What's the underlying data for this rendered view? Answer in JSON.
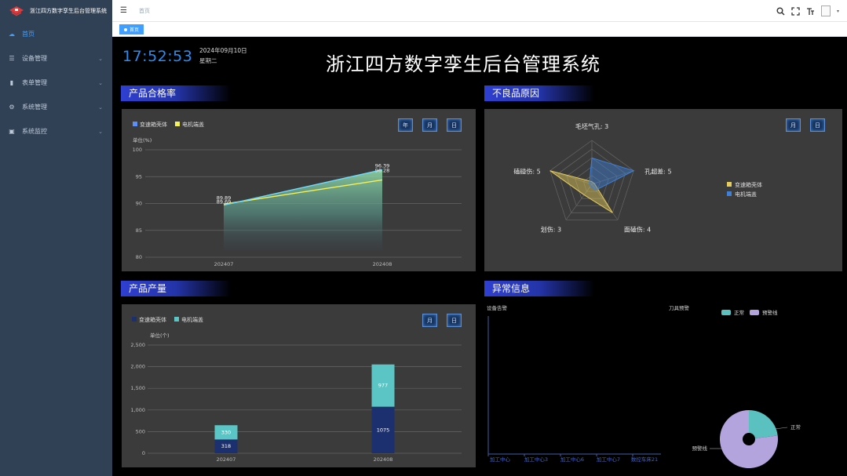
{
  "app": {
    "title": "浙江四方数字孪生后台管理系统"
  },
  "sidebar": {
    "items": [
      {
        "label": "首页",
        "icon": "dashboard-icon",
        "active": true
      },
      {
        "label": "设备管理",
        "icon": "device-icon"
      },
      {
        "label": "表单管理",
        "icon": "chart-bar-icon"
      },
      {
        "label": "系统管理",
        "icon": "gear-icon"
      },
      {
        "label": "系统监控",
        "icon": "monitor-icon"
      }
    ]
  },
  "topbar": {
    "breadcrumb": "首页"
  },
  "tags": {
    "active": "首页"
  },
  "dashboard": {
    "time": "17:52:53",
    "date": "2024年09月10日",
    "weekday": "星期二",
    "title": "浙江四方数字孪生后台管理系统"
  },
  "sections": {
    "pass_rate": {
      "title": "产品合格率",
      "buttons": [
        "年",
        "月",
        "日"
      ]
    },
    "defect": {
      "title": "不良品原因",
      "buttons": [
        "月",
        "日"
      ]
    },
    "output": {
      "title": "产品产量",
      "buttons": [
        "月",
        "日"
      ]
    },
    "abnormal": {
      "title": "异常信息",
      "sub_left": "设备告警",
      "sub_right": "刀具预警"
    }
  },
  "chart_data": [
    {
      "type": "area",
      "ylabel": "单位(%)",
      "categories": [
        "202407",
        "202408"
      ],
      "ylim": [
        80,
        100
      ],
      "yticks": [
        "80",
        "85",
        "90",
        "95",
        "100"
      ],
      "series": [
        {
          "name": "变速箱壳体",
          "color": "#5b8ff9",
          "values": [
            89.69,
            96.28
          ]
        },
        {
          "name": "电机端盖",
          "color": "#f6f155",
          "values": [
            89.89,
            94.39
          ]
        }
      ],
      "labels": {
        "series1": [
          "89.69",
          "96.28"
        ],
        "series2": [
          "89.89",
          "96.39"
        ]
      },
      "legend": "top-left",
      "grid": true
    },
    {
      "type": "radar",
      "indicators": [
        {
          "name": "毛坯气孔",
          "value": "3"
        },
        {
          "name": "孔超差",
          "value": "5"
        },
        {
          "name": "面磕伤",
          "value": "4"
        },
        {
          "name": "划伤",
          "value": "3"
        },
        {
          "name": "磕碰伤",
          "value": "5"
        }
      ],
      "max": 5,
      "series": [
        {
          "name": "变速箱壳体",
          "color": "#e6cc5c",
          "values": [
            0.3,
            0.3,
            4,
            1.5,
            5
          ]
        },
        {
          "name": "电机端盖",
          "color": "#3f7fd8",
          "values": [
            3,
            5,
            0.8,
            0.3,
            0.3
          ]
        }
      ],
      "legend": "right"
    },
    {
      "type": "bar",
      "stacked": true,
      "ylabel": "单位(个)",
      "categories": [
        "202407",
        "202408"
      ],
      "ylim": [
        0,
        2500
      ],
      "yticks": [
        "0",
        "500",
        "1,000",
        "1,500",
        "2,000",
        "2,500"
      ],
      "series": [
        {
          "name": "变速箱壳体",
          "color": "#1c2f6e",
          "values": [
            318,
            1075
          ]
        },
        {
          "name": "电机端盖",
          "color": "#5bc4c4",
          "values": [
            330,
            977
          ]
        }
      ],
      "legend": "top-left",
      "grid": true
    },
    {
      "type": "bar",
      "categories": [
        "加工中心",
        "加工中心3",
        "加工中心6",
        "加工中心7",
        "数控车床21"
      ],
      "values": [],
      "grid": false
    },
    {
      "type": "pie",
      "legend": "top",
      "slices": [
        {
          "name": "正常",
          "color": "#5bc0c0",
          "value": 23
        },
        {
          "name": "预警线",
          "color": "#b3a4dd",
          "value": 77
        }
      ]
    }
  ]
}
